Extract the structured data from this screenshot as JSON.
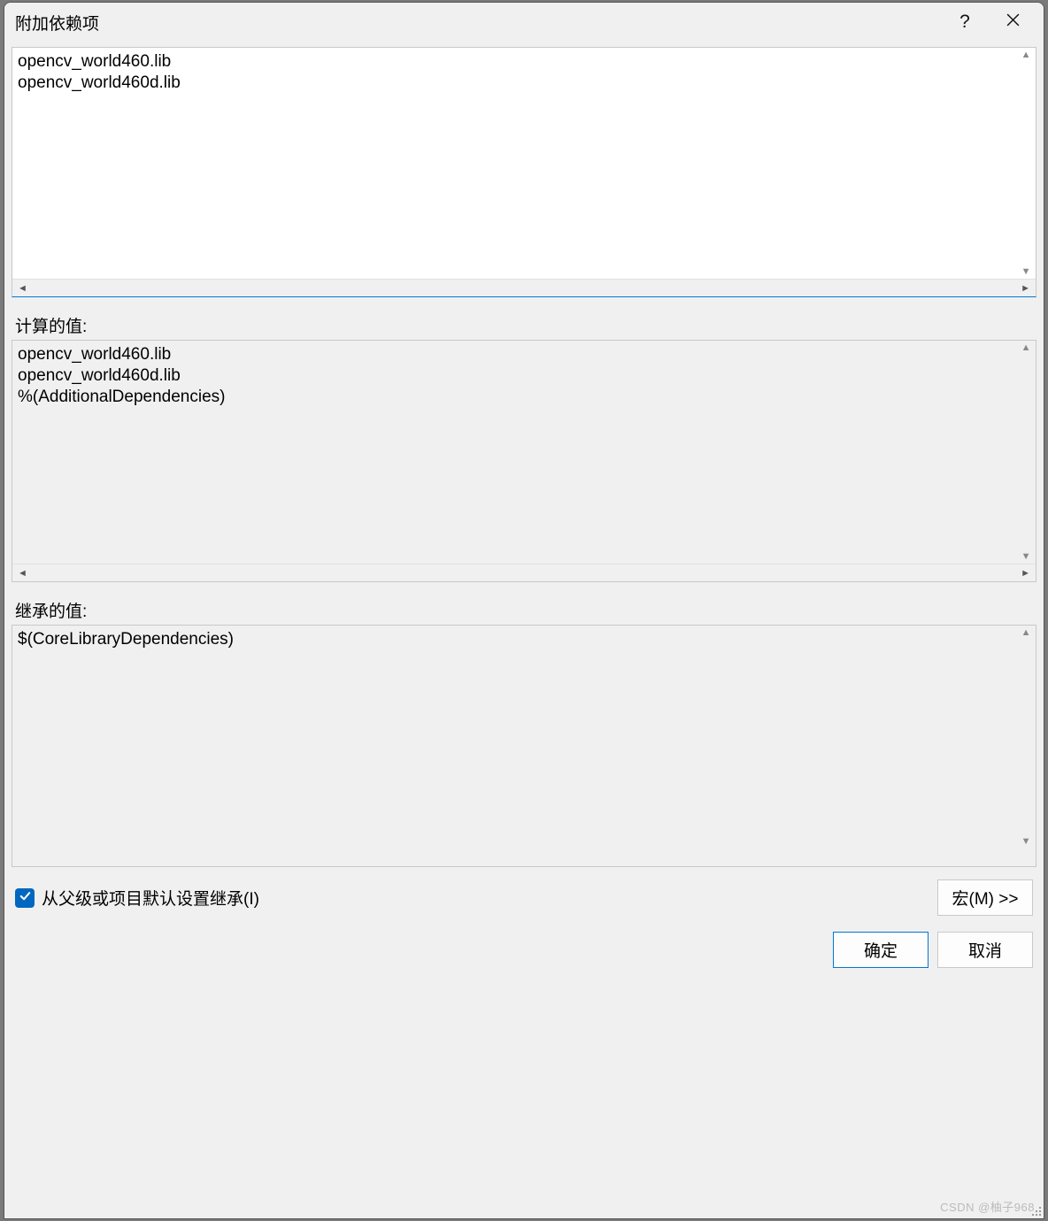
{
  "dialog": {
    "title": "附加依赖项",
    "help_symbol": "?",
    "close_symbol": "X"
  },
  "editor": {
    "value": "opencv_world460.lib\nopencv_world460d.lib"
  },
  "computed": {
    "label": "计算的值:",
    "lines": "opencv_world460.lib\nopencv_world460d.lib\n%(AdditionalDependencies)"
  },
  "inherited": {
    "label": "继承的值:",
    "lines": "$(CoreLibraryDependencies)"
  },
  "footer": {
    "inherit_checkbox_checked": true,
    "inherit_label": "从父级或项目默认设置继承(I)",
    "macro_button": "宏(M) >>",
    "ok_button": "确定",
    "cancel_button": "取消"
  },
  "watermark": "CSDN @柚子968"
}
